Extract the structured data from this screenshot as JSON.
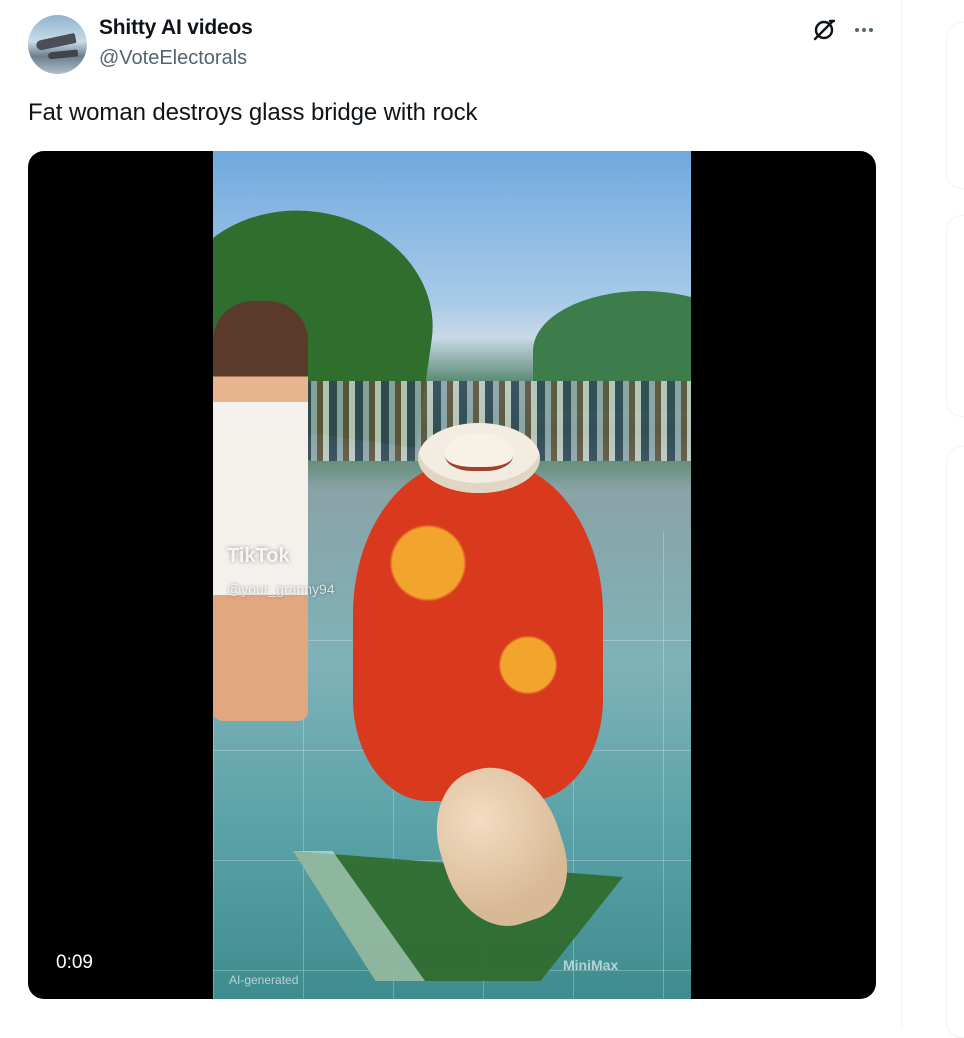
{
  "author": {
    "name": "Shitty AI videos",
    "handle": "@VoteElectorals",
    "avatar_icon": "fighter-jets-avatar"
  },
  "actions": {
    "grok_icon": "grok-icon",
    "more_icon": "more-icon"
  },
  "tweet": {
    "text": "Fat woman destroys glass bridge with rock"
  },
  "media": {
    "watermark_app": "TikTok",
    "watermark_user": "@your_granny94",
    "ai_label": "AI-generated",
    "brand_watermark": "MiniMax",
    "duration": "0:09"
  }
}
